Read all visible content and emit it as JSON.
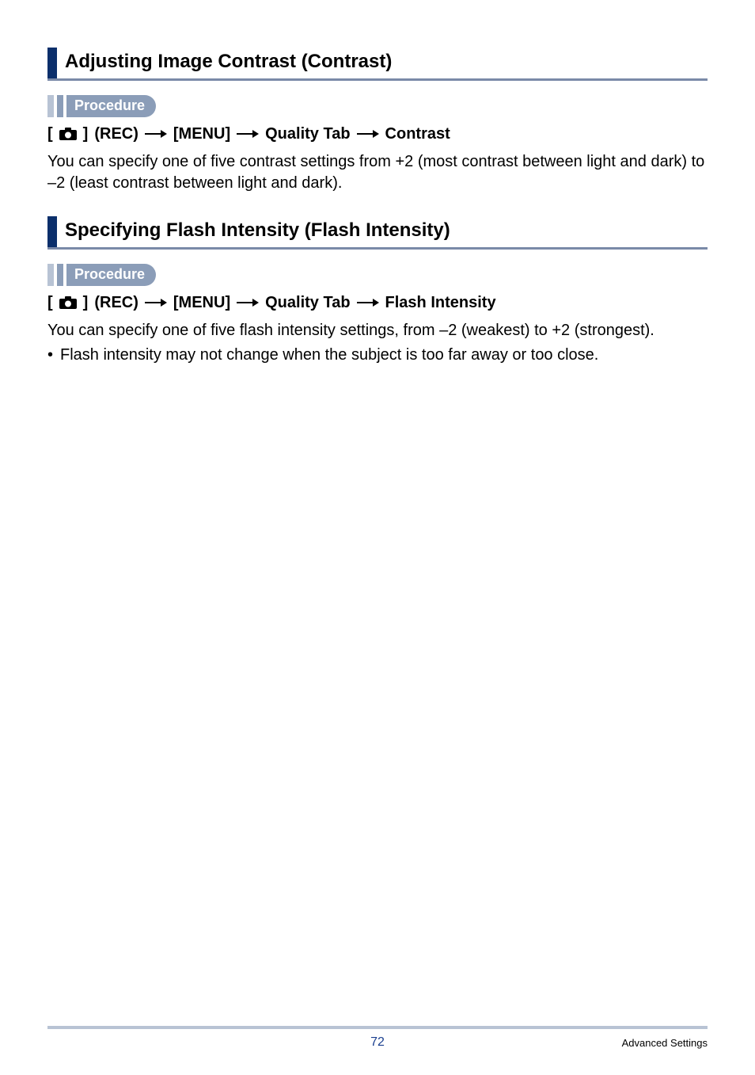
{
  "section1": {
    "title": "Adjusting Image Contrast (Contrast)",
    "procedure_label": "Procedure",
    "breadcrumb": {
      "bracket_open": "[",
      "bracket_close": "]",
      "rec": "(REC)",
      "menu": "[MENU]",
      "tab": "Quality Tab",
      "item": "Contrast"
    },
    "body": "You can specify one of five contrast settings from +2 (most contrast between light and dark) to –2 (least contrast between light and dark)."
  },
  "section2": {
    "title": "Specifying Flash Intensity (Flash Intensity)",
    "procedure_label": "Procedure",
    "breadcrumb": {
      "bracket_open": "[",
      "bracket_close": "]",
      "rec": "(REC)",
      "menu": "[MENU]",
      "tab": "Quality Tab",
      "item": "Flash Intensity"
    },
    "body": "You can specify one of five flash intensity settings, from –2 (weakest) to +2 (strongest).",
    "bullet": "Flash intensity may not change when the subject is too far away or too close."
  },
  "footer": {
    "page": "72",
    "section": "Advanced Settings"
  }
}
